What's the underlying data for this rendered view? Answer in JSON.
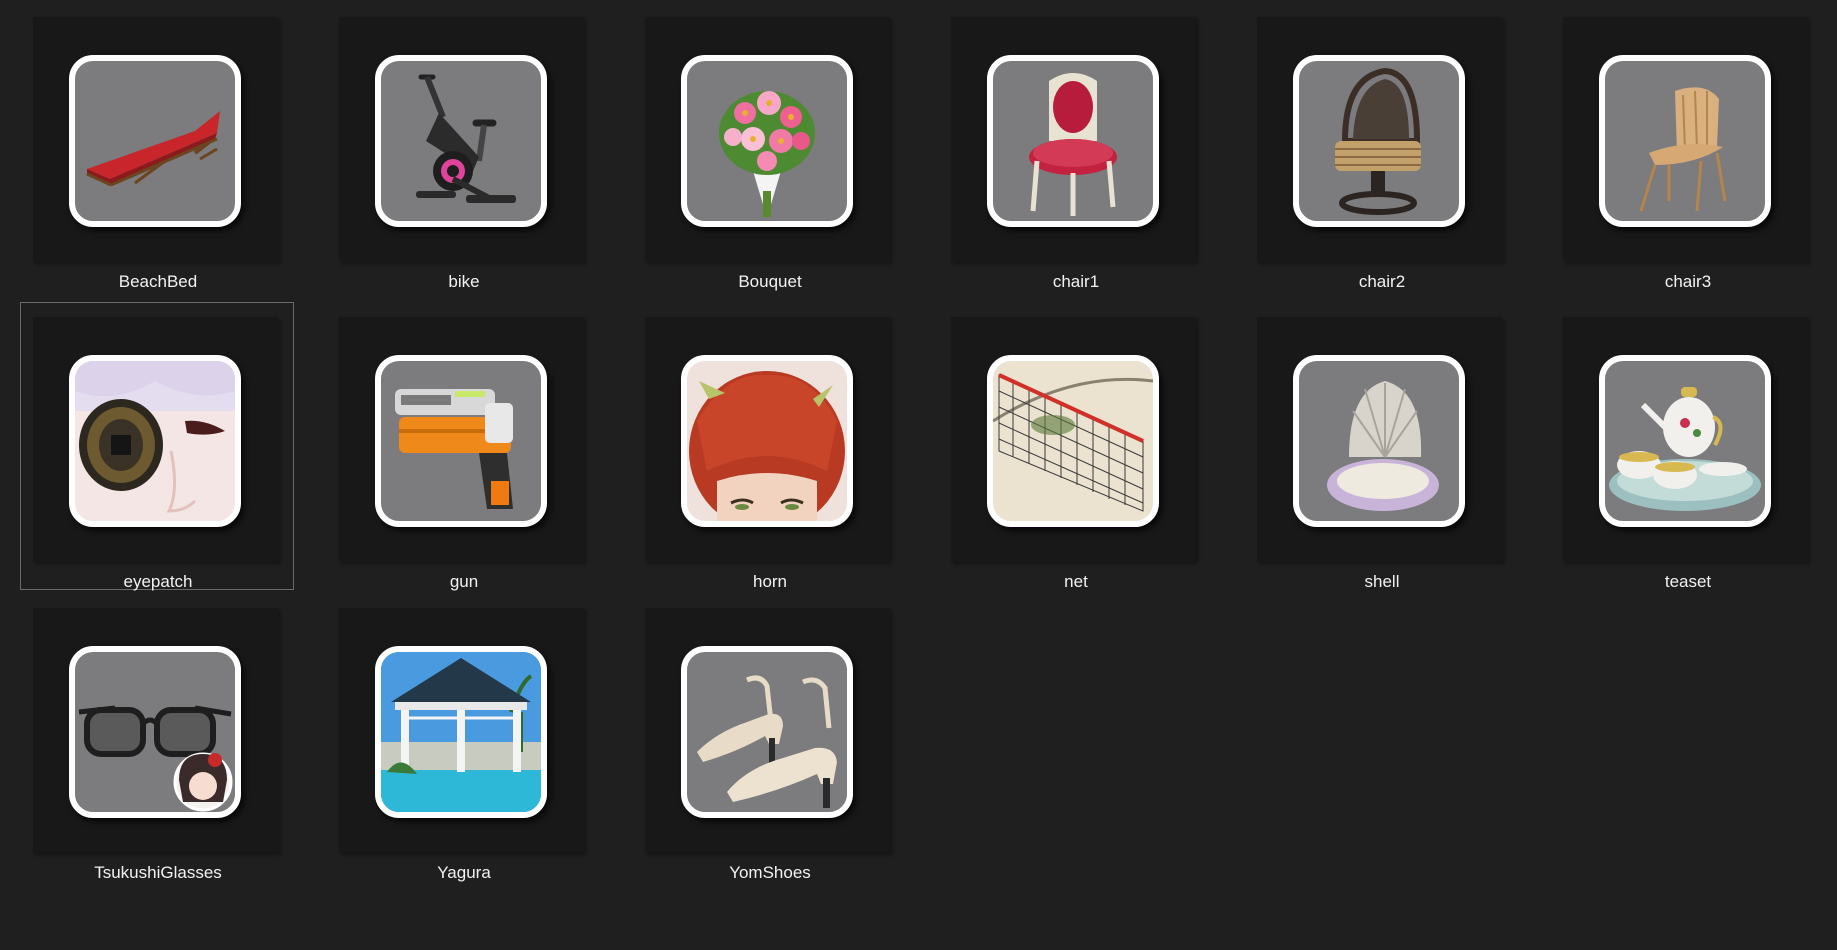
{
  "files": [
    {
      "name": "BeachBed",
      "icon": "beach-bed-icon"
    },
    {
      "name": "bike",
      "icon": "exercise-bike-icon"
    },
    {
      "name": "Bouquet",
      "icon": "flower-bouquet-icon"
    },
    {
      "name": "chair1",
      "icon": "red-cushion-chair-icon"
    },
    {
      "name": "chair2",
      "icon": "rattan-swivel-chair-icon"
    },
    {
      "name": "chair3",
      "icon": "bamboo-chair-icon"
    },
    {
      "name": "eyepatch",
      "icon": "eyepatch-icon",
      "selected": true
    },
    {
      "name": "gun",
      "icon": "toy-gun-icon"
    },
    {
      "name": "horn",
      "icon": "horned-hair-icon"
    },
    {
      "name": "net",
      "icon": "beach-volleyball-net-icon"
    },
    {
      "name": "shell",
      "icon": "seashell-icon"
    },
    {
      "name": "teaset",
      "icon": "tea-set-icon"
    },
    {
      "name": "TsukushiGlasses",
      "icon": "glasses-icon"
    },
    {
      "name": "Yagura",
      "icon": "gazebo-icon"
    },
    {
      "name": "YomShoes",
      "icon": "high-heel-shoes-icon"
    }
  ],
  "colors": {
    "background": "#1f1f1f",
    "tile": "#181818",
    "thumbnail_bg": "#7c7b7e",
    "label": "#f2f2f2",
    "selection_border": "#6a6a6a"
  }
}
